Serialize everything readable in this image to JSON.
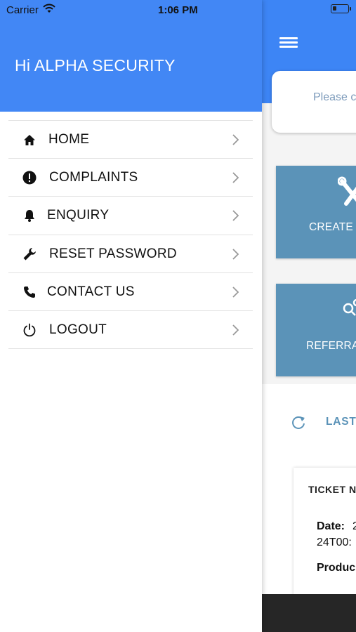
{
  "status_bar": {
    "carrier": "Carrier",
    "time": "1:06 PM"
  },
  "drawer": {
    "greeting": "Hi ALPHA SECURITY",
    "header_color": "#4287f5",
    "items": [
      {
        "label": "HOME",
        "icon": "home-icon"
      },
      {
        "label": "COMPLAINTS",
        "icon": "info-icon"
      },
      {
        "label": "ENQUIRY",
        "icon": "bell-icon"
      },
      {
        "label": "RESET PASSWORD",
        "icon": "wrench-icon"
      },
      {
        "label": "CONTACT US",
        "icon": "phone-icon"
      },
      {
        "label": "LOGOUT",
        "icon": "power-icon"
      }
    ]
  },
  "main": {
    "search_placeholder": "Please c",
    "tiles": [
      {
        "label": "CREATE",
        "icon": "tools-icon"
      },
      {
        "label": "REFERRA",
        "icon": "share-icon"
      }
    ],
    "last_label": "LAST",
    "ticket": {
      "number_label": "TICKET N",
      "date_label": "Date:",
      "date_value_1": "2",
      "date_value_2": "24T00:",
      "product_label": "Produc"
    },
    "colors": {
      "header": "#3d85f5",
      "tile": "#5b93b8",
      "accent_text": "#5b93b8"
    }
  }
}
